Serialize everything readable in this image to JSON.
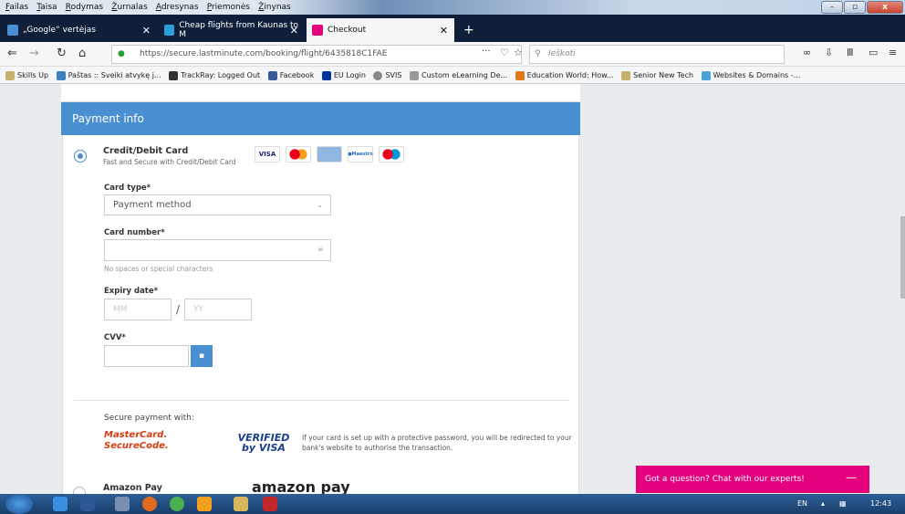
{
  "menubar": {
    "items": [
      "Failas",
      "Taisa",
      "Rodymas",
      "Žurnalas",
      "Adresynas",
      "Priemonės",
      "Žinynas"
    ]
  },
  "tabs": [
    {
      "label": "„Google“ vertėjas"
    },
    {
      "label": "Cheap flights from Kaunas to M"
    },
    {
      "label": "Checkout"
    }
  ],
  "navbar": {
    "url": "https://secure.lastminute.com/booking/flight/6435818C1FAE",
    "search_placeholder": "Ieškoti"
  },
  "bookmarks": [
    "Skills Up",
    "Paštas :: Sveiki atvykę j...",
    "TrackRay: Logged Out",
    "Facebook",
    "EU Login",
    "SVIS",
    "Custom eLearning De...",
    "Education World: How...",
    "Senior New Tech",
    "Websites & Domains -..."
  ],
  "payment": {
    "header": "Payment info",
    "credit_title": "Credit/Debit Card",
    "credit_sub": "Fast and Secure with Credit/Debit Card",
    "card_logos": [
      "VISA",
      "MC",
      "AMEX",
      "Maestro",
      "MC"
    ],
    "card_type_label": "Card type*",
    "card_type_value": "Payment method",
    "card_number_label": "Card number*",
    "card_number_hint": "No spaces or special characters",
    "expiry_label": "Expiry date*",
    "mm_placeholder": "MM",
    "yy_placeholder": "YY",
    "cvv_label": "CVV*",
    "secure_label": "Secure payment with:",
    "mastercard_brand": "MasterCard. SecureCode.",
    "verified_brand": "VERIFIED by VISA",
    "secure_text": "If your card is set up with a protective password, you will be redirected to your bank's website to authorise the transaction.",
    "amazon_label": "Amazon Pay",
    "amazon_logo": "amazon pay"
  },
  "chat": {
    "label": "Got a question? Chat with our experts!"
  },
  "taskbar": {
    "lang": "EN",
    "time": "12:43"
  },
  "colors": {
    "accent": "#4a8fd2",
    "chat": "#e5007e"
  }
}
